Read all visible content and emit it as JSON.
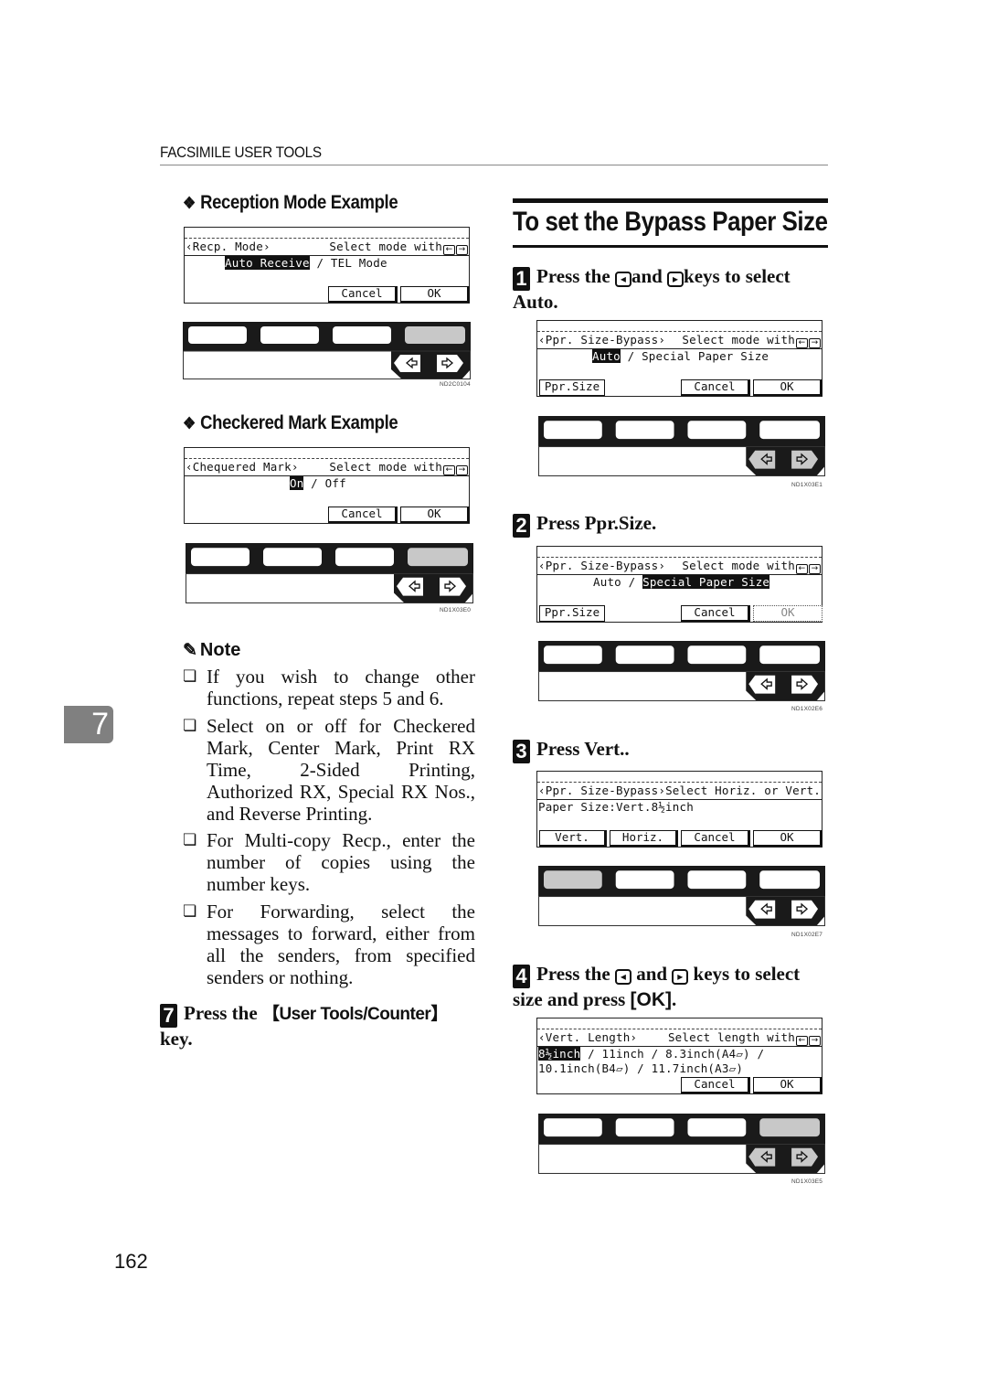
{
  "header": {
    "running_title": "FACSIMILE USER TOOLS"
  },
  "left_column": {
    "reception_example": {
      "title": "Reception Mode Example",
      "lcd": {
        "title_left": "‹Recp. Mode›",
        "title_right": "Select mode with",
        "options_selected": "Auto Receive",
        "options_rest": " / TEL Mode",
        "buttons": [
          "Cancel",
          "OK"
        ]
      },
      "panel_code": "ND2C0104"
    },
    "checkered_example": {
      "title": "Checkered Mark Example",
      "lcd": {
        "title_left": "‹Chequered Mark›",
        "title_right": "Select mode with",
        "options_selected": "On",
        "options_rest": " / Off",
        "buttons": [
          "Cancel",
          "OK"
        ]
      },
      "panel_code": "ND1X03E0"
    },
    "note": {
      "title": "Note",
      "items": [
        "If you wish to change other functions, repeat steps 5 and 6.",
        "Select on or off for Checkered Mark, Center Mark, Print RX Time, 2-Sided Printing, Authorized RX, Special RX Nos., and Reverse Printing.",
        "For Multi-copy Recp., enter the number of copies using the number keys.",
        "For Forwarding, select the messages to forward, either from all the senders, from specified senders or nothing."
      ]
    },
    "step7": {
      "number": "7",
      "pre": "Press the ",
      "key": "【User Tools/Counter】",
      "post": " key."
    }
  },
  "right_column": {
    "section_title": "To set the Bypass Paper Size",
    "steps": [
      {
        "number": "1",
        "text_a": "Press the ",
        "text_b": "and ",
        "text_c": "keys to select Auto.",
        "lcd": {
          "title_left": "‹Ppr. Size-Bypass›",
          "title_right": "Select mode with",
          "options_selected": "Auto",
          "options_rest": " / Special Paper Size",
          "buttons": [
            "Ppr.Size",
            "Cancel",
            "OK"
          ]
        },
        "panel_code": "ND1X03E1"
      },
      {
        "number": "2",
        "text": "Press Ppr.Size.",
        "lcd": {
          "title_left": "‹Ppr. Size-Bypass›",
          "title_right": "Select mode with",
          "options_before": "Auto / ",
          "options_selected": "Special Paper Size",
          "buttons": [
            "Ppr.Size",
            "Cancel",
            "OK"
          ]
        },
        "panel_code": "ND1X02E6"
      },
      {
        "number": "3",
        "text": "Press Vert..",
        "lcd": {
          "title_left": "‹Ppr. Size-Bypass›",
          "title_right": "Select Horiz. or Vert.",
          "line": "Paper Size:Vert.8½inch",
          "buttons": [
            "Vert.",
            "Horiz.",
            "Cancel",
            "OK"
          ]
        },
        "panel_code": "ND1X02E7"
      },
      {
        "number": "4",
        "text_a": "Press  the ",
        "text_b": " and ",
        "text_c": " keys to select size and press ",
        "key": "[OK]",
        "text_d": ".",
        "lcd": {
          "title_left": "‹Vert. Length›",
          "title_right": "Select length with",
          "line1_selected": "8½inch",
          "line1_rest": " / 11inch / 8.3inch(A4▱) /",
          "line2": "10.1inch(B4▱) / 11.7inch(A3▱)",
          "buttons": [
            "Cancel",
            "OK"
          ]
        },
        "panel_code": "ND1X03E5"
      }
    ]
  },
  "chapter_tab": "7",
  "page_number": "162",
  "icons": {
    "left_arrow_key": "◂",
    "right_arrow_key": "▸",
    "small_left": "←",
    "small_right": "→",
    "checkbox": "❏",
    "diamond": "❖",
    "pencil": "✎"
  }
}
